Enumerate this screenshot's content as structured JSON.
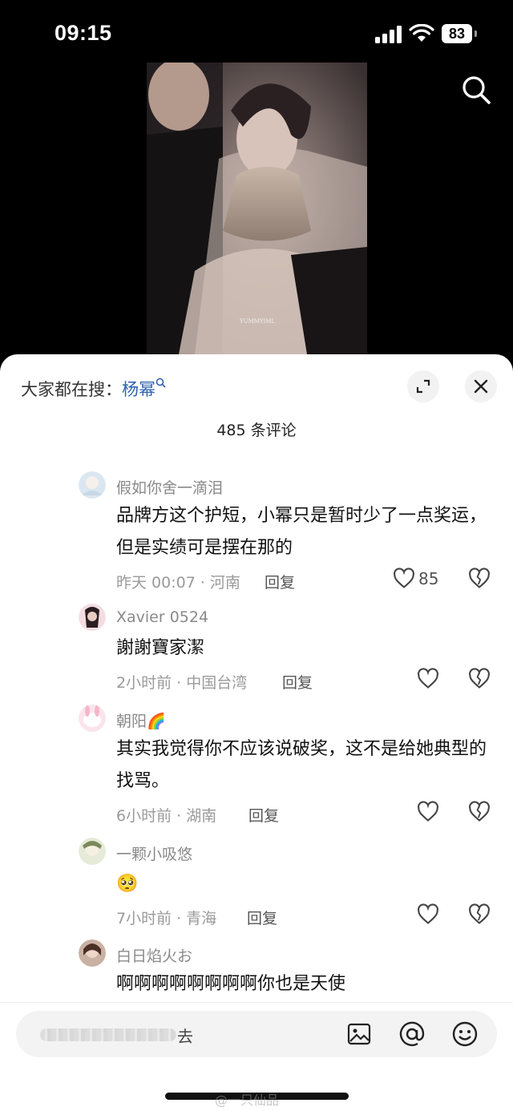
{
  "status_bar": {
    "time": "09:15",
    "battery": "83"
  },
  "video": {
    "watermark_text": "YUMMYIML"
  },
  "sheet": {
    "hot_prefix": "大家都在搜：",
    "hot_keyword": "杨幂",
    "comment_count": "485 条评论"
  },
  "comments": [
    {
      "name": "假如你舍一滴泪",
      "text": "品牌方这个护短，小幂只是暂时少了一点奖运，但是实绩可是摆在那的",
      "meta": "昨天 00:07 · 河南",
      "reply": "回复",
      "likes": "85"
    },
    {
      "name": "Xavier 0524",
      "text": "謝謝寶家潔",
      "meta": "2小时前 · 中国台湾",
      "reply": "回复",
      "likes": ""
    },
    {
      "name": "朝阳🌈",
      "text": "其实我觉得你不应该说破奖，这不是给她典型的找骂。",
      "meta": "6小时前 · 湖南",
      "reply": "回复",
      "likes": ""
    },
    {
      "name": "一颗小吸悠",
      "text": "🥺",
      "meta": "7小时前 · 青海",
      "reply": "回复",
      "likes": ""
    },
    {
      "name": "白日焰火お",
      "text": "啊啊啊啊啊啊啊啊你也是天使",
      "meta": "",
      "reply": "",
      "likes": ""
    }
  ],
  "input": {
    "placeholder_tail": "去"
  },
  "watermark": "@一只仙品",
  "colors": {
    "accent": "#2f62b0",
    "sheet_bg": "#ffffff"
  }
}
